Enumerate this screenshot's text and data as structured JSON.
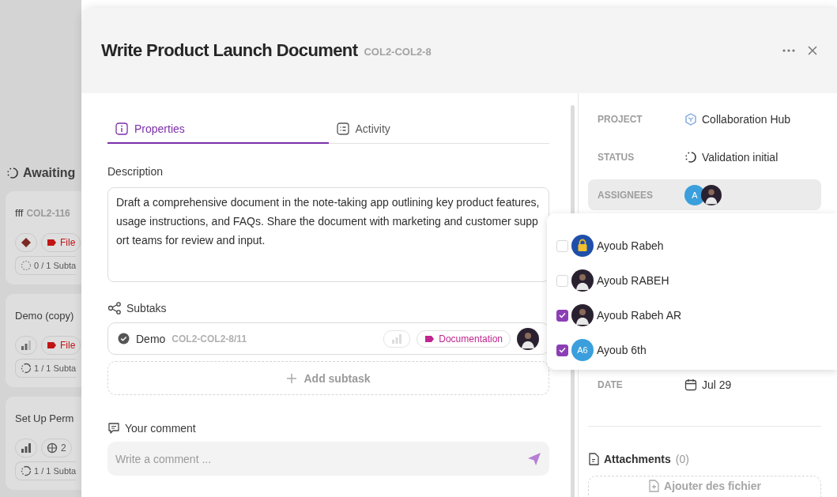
{
  "board": {
    "column_title": "Awaiting",
    "cards": [
      {
        "title": "fff",
        "id": "COL2-116",
        "chips": [
          {
            "kind": "urgent"
          },
          {
            "kind": "tag",
            "label": "File"
          }
        ],
        "subtasks": "0 / 1 Subta",
        "subtasks_done": false
      },
      {
        "title": "Demo (copy)",
        "chips": [
          {
            "kind": "low"
          },
          {
            "kind": "tag",
            "label": "File"
          }
        ],
        "subtasks": "1 / 1 Subta",
        "subtasks_done": true
      },
      {
        "title": "Set Up Perm",
        "chips": [
          {
            "kind": "high"
          },
          {
            "kind": "count",
            "label": "2"
          }
        ],
        "subtasks": "1 / 1 Subta",
        "subtasks_done": true
      }
    ]
  },
  "modal": {
    "title": "Write Product Launch Document",
    "id": "COL2-COL2-8"
  },
  "tabs": [
    {
      "label": "Properties",
      "selected": true
    },
    {
      "label": "Activity",
      "selected": false
    }
  ],
  "description": {
    "label": "Description",
    "text": "Draft a comprehensive document in the note-taking app outlining key product features, usage instructions, and FAQs. Share the document with marketing and customer support teams for review and input."
  },
  "subtasks": {
    "heading": "Subtaks",
    "items": [
      {
        "title": "Demo",
        "id": "COL2-COL2-8/11",
        "done": true,
        "tag": "Documentation"
      }
    ],
    "add_label": "Add subtask"
  },
  "comment": {
    "heading": "Your comment",
    "placeholder": "Write a comment ..."
  },
  "properties": [
    {
      "kind": "project",
      "label": "PROJECT",
      "value": "Collaboration Hub"
    },
    {
      "kind": "status",
      "label": "STATUS",
      "value": "Validation initial"
    },
    {
      "kind": "assignees",
      "label": "ASSIGNEES",
      "avatars": [
        {
          "kind": "initials",
          "initials": "A"
        },
        {
          "kind": "photo"
        }
      ]
    },
    {
      "kind": "date",
      "label": "DATE",
      "value": "Jul 29"
    }
  ],
  "assignee_menu": {
    "options": [
      {
        "name": "Ayoub Rabeh",
        "checked": false,
        "avatar": {
          "kind": "lock"
        }
      },
      {
        "name": "Ayoub RABEH",
        "checked": false,
        "avatar": {
          "kind": "photo"
        }
      },
      {
        "name": "Ayoub Rabeh AR",
        "checked": true,
        "avatar": {
          "kind": "photo"
        }
      },
      {
        "name": "Ayoub 6th",
        "checked": true,
        "avatar": {
          "kind": "initials",
          "initials": "A6"
        }
      }
    ]
  },
  "attachments": {
    "heading": "Attachments",
    "count": "(0)",
    "upload_label": "Ajouter des fichier"
  }
}
